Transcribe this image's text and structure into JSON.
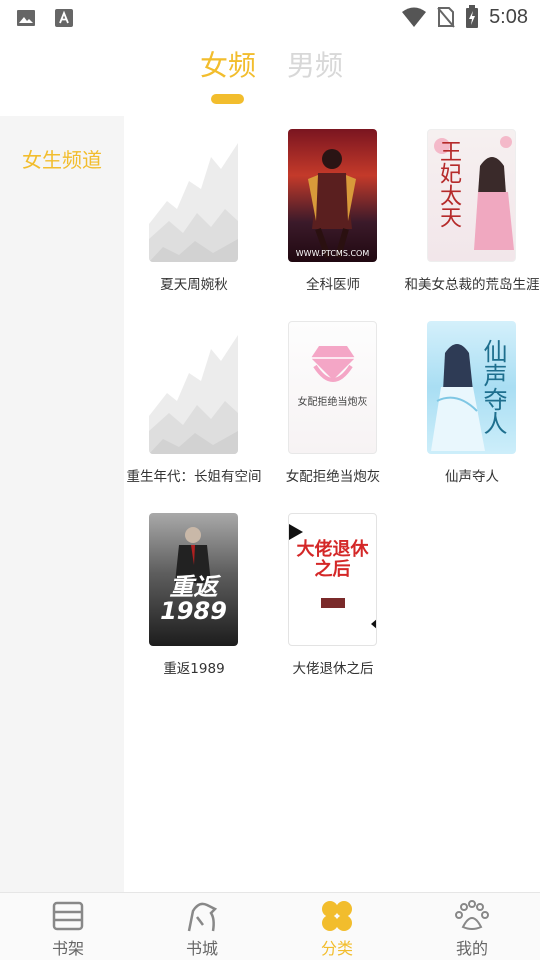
{
  "status_bar": {
    "time": "5:08",
    "icons": [
      "image-icon",
      "text-a-icon",
      "wifi-icon",
      "no-sim-icon",
      "battery-icon"
    ]
  },
  "header": {
    "tabs": [
      {
        "label": "女频",
        "active": true
      },
      {
        "label": "男频",
        "active": false
      }
    ]
  },
  "sidebar": {
    "items": [
      {
        "label": "女生频道",
        "active": true
      }
    ]
  },
  "books": [
    {
      "title": "夏天周婉秋",
      "cover": "placeholder"
    },
    {
      "title": "全科医师",
      "cover": "c1",
      "cover_text": "WWW.PTCMS.COM"
    },
    {
      "title": "和美女总裁的荒岛生涯",
      "cover": "c2",
      "cover_text": "王妃太天"
    },
    {
      "title": "重生年代：长姐有空间",
      "cover": "placeholder"
    },
    {
      "title": "女配拒绝当炮灰",
      "cover": "c3",
      "cover_text": "女配拒绝当炮灰"
    },
    {
      "title": "仙声夺人",
      "cover": "c4",
      "cover_text": "仙声夺人"
    },
    {
      "title": "重返1989",
      "cover": "c5",
      "cover_text": "重返1989"
    },
    {
      "title": "大佬退休之后",
      "cover": "c6",
      "cover_text": "大佬退休之后"
    }
  ],
  "bottom_nav": {
    "items": [
      {
        "label": "书架",
        "icon": "bookshelf-icon",
        "active": false
      },
      {
        "label": "书城",
        "icon": "bookstore-icon",
        "active": false
      },
      {
        "label": "分类",
        "icon": "category-icon",
        "active": true
      },
      {
        "label": "我的",
        "icon": "paw-icon",
        "active": false
      }
    ]
  },
  "colors": {
    "accent": "#f2bd2d",
    "inactive_tab": "#d8d8d8",
    "sidebar_bg": "#f5f5f5",
    "text": "#333333",
    "nav_inactive": "#666666"
  }
}
